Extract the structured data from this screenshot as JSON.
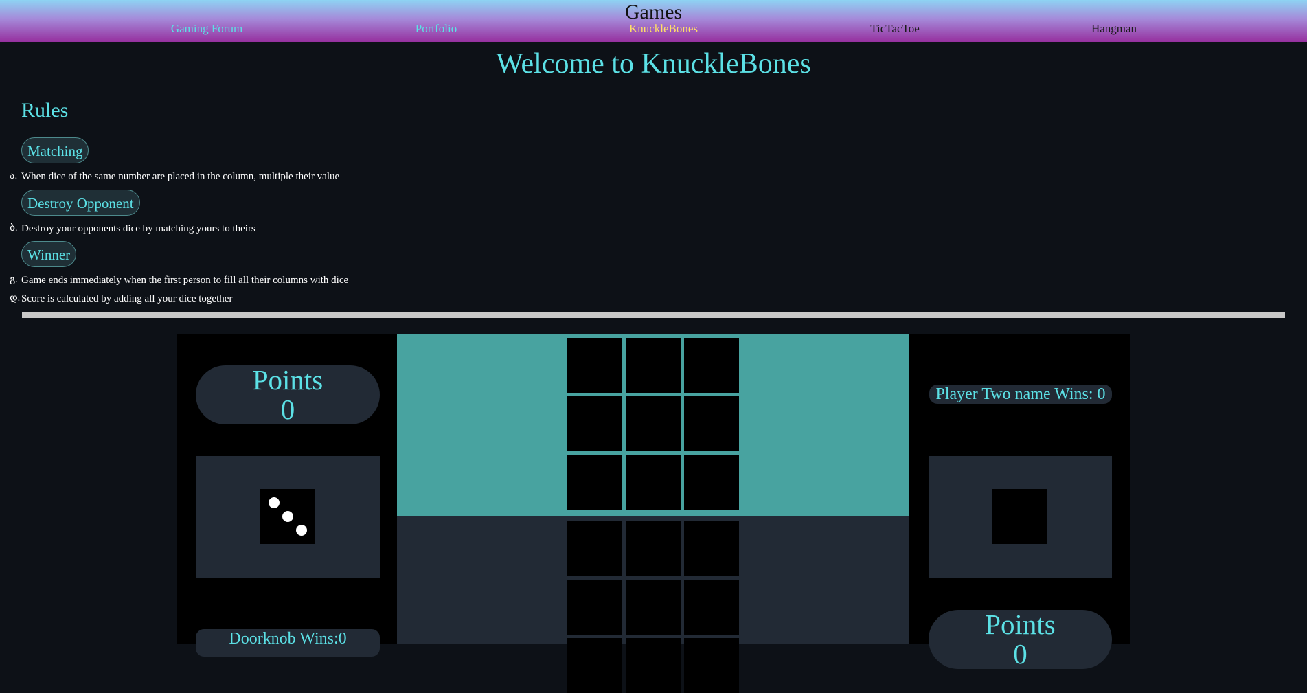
{
  "header": {
    "title": "Games",
    "nav": [
      {
        "label": "Gaming Forum",
        "color": "#5ce1e6"
      },
      {
        "label": "Portfolio",
        "color": "#5ce1e6"
      },
      {
        "label": "KnuckleBones",
        "color": "#ffe066"
      },
      {
        "label": "TicTacToe",
        "color": "#1a1a1a"
      },
      {
        "label": "Hangman",
        "color": "#1a1a1a"
      }
    ]
  },
  "main": {
    "title": "Welcome to KnuckleBones",
    "rules_heading": "Rules",
    "sections": [
      {
        "heading": "Matching",
        "items": [
          {
            "marker": "ა.",
            "text": "When dice of the same number are placed in the column, multiple their value"
          }
        ]
      },
      {
        "heading": "Destroy Opponent",
        "items": [
          {
            "marker": "ბ.",
            "text": "Destroy your opponents dice by matching yours to theirs"
          }
        ]
      },
      {
        "heading": "Winner",
        "items": [
          {
            "marker": "გ.",
            "text": "Game ends immediately when the first person to fill all their columns with dice"
          },
          {
            "marker": "დ.",
            "text": "Score is calculated by adding all your dice together"
          }
        ]
      }
    ]
  },
  "game": {
    "player_one": {
      "points_label": "Points",
      "points_value": "0",
      "wins_label": "Doorknob Wins:0",
      "current_die": 3
    },
    "player_two": {
      "points_label": "Points",
      "points_value": "0",
      "wins_label": "Player Two name Wins: 0",
      "current_die": 0
    },
    "colors": {
      "active_board": "#48a3a0",
      "inactive_board": "#222a35",
      "accent": "#5ce1e6"
    }
  }
}
